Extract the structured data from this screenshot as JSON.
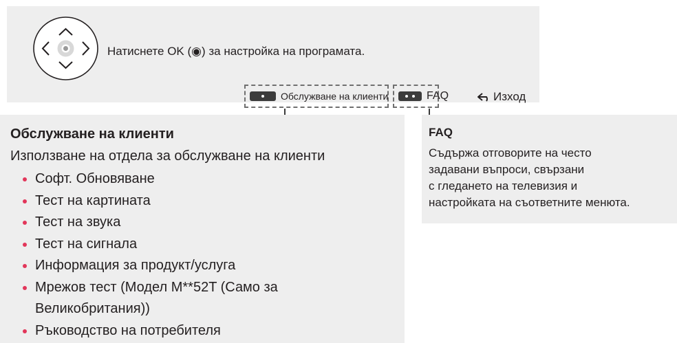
{
  "top_panel": {
    "icons": {
      "navigation": "remote-ok-dial-icon",
      "back": "back-arrow-icon",
      "red_key": "remote-red-key-icon",
      "color_keys": "remote-color-keys-icon"
    },
    "instruction": "Натиснете OK (◉) за настройка на програмата.",
    "customer_service_key_label": "Обслужване на клиенти",
    "faq_key_label": "FAQ",
    "exit_label": "Изход"
  },
  "customer_service": {
    "title": "Обслужване на клиенти",
    "description": "Използване на отдела за обслужване на клиенти",
    "items": [
      "Софт. Обновяване",
      "Тест на картината",
      "Тест на звука",
      "Тест на сигнала",
      "Информация за продукт/услуга",
      "Мрежов тест (Модел M**52T (Само за",
      "Великобритания))",
      "Ръководство на потребителя"
    ]
  },
  "faq": {
    "title": "FAQ",
    "description_lines": [
      "Съдържа отговорите на често",
      "задавани въпроси, свързани",
      "с гледането на телевизия и",
      "настройката на съответните менюта."
    ]
  }
}
